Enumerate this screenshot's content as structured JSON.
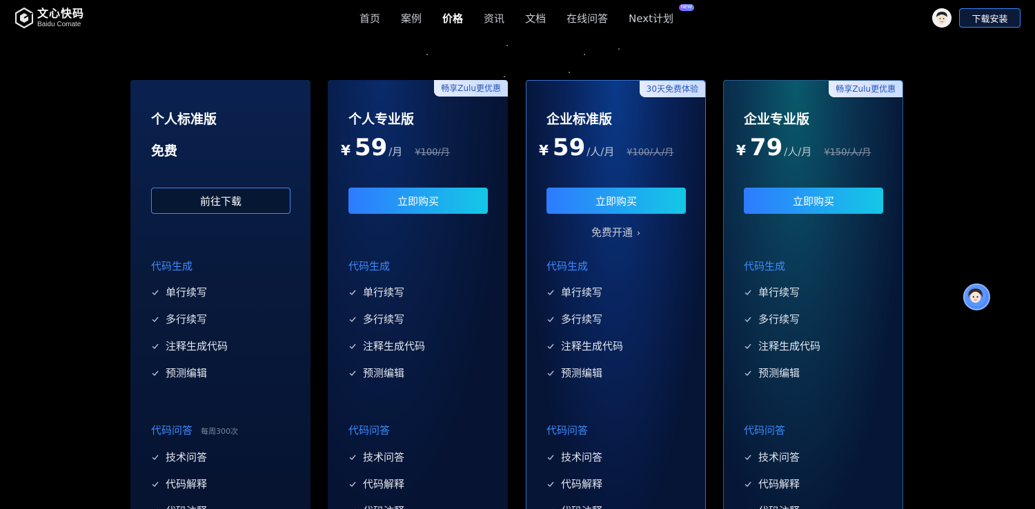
{
  "header": {
    "logo_cn": "文心快码",
    "logo_en": "Baidu Comate",
    "nav": [
      {
        "label": "首页"
      },
      {
        "label": "案例"
      },
      {
        "label": "价格"
      },
      {
        "label": "资讯"
      },
      {
        "label": "文档"
      },
      {
        "label": "在线问答"
      },
      {
        "label": "Next计划",
        "badge": "NEW"
      }
    ],
    "active_nav": "价格",
    "download_label": "下载安装"
  },
  "plans": [
    {
      "title": "个人标准版",
      "price_free": "免费",
      "button": "前往下载",
      "sections": [
        {
          "title": "代码生成",
          "features": [
            "单行续写",
            "多行续写",
            "注释生成代码",
            "预测编辑"
          ]
        },
        {
          "title": "代码问答",
          "note": "每周300次",
          "features": [
            "技术问答",
            "代码解释",
            "代码注释"
          ]
        }
      ]
    },
    {
      "tag": "畅享Zulu更优惠",
      "title": "个人专业版",
      "currency": "¥",
      "amount": "59",
      "unit": "/月",
      "original": "¥100/月",
      "button": "立即购买",
      "sections": [
        {
          "title": "代码生成",
          "features": [
            "单行续写",
            "多行续写",
            "注释生成代码",
            "预测编辑"
          ]
        },
        {
          "title": "代码问答",
          "features": [
            "技术问答",
            "代码解释",
            "代码注释"
          ]
        }
      ]
    },
    {
      "tag": "30天免费体验",
      "title": "企业标准版",
      "currency": "¥",
      "amount": "59",
      "unit": "/人/月",
      "original": "¥100/人/月",
      "button": "立即购买",
      "free_link": "免费开通",
      "sections": [
        {
          "title": "代码生成",
          "features": [
            "单行续写",
            "多行续写",
            "注释生成代码",
            "预测编辑"
          ]
        },
        {
          "title": "代码问答",
          "features": [
            "技术问答",
            "代码解释",
            "代码注释"
          ]
        }
      ]
    },
    {
      "tag": "畅享Zulu更优惠",
      "title": "企业专业版",
      "currency": "¥",
      "amount": "79",
      "unit": "/人/月",
      "original": "¥150/人/月",
      "button": "立即购买",
      "sections": [
        {
          "title": "代码生成",
          "features": [
            "单行续写",
            "多行续写",
            "注释生成代码",
            "预测编辑"
          ]
        },
        {
          "title": "代码问答",
          "features": [
            "技术问答",
            "代码解释",
            "代码注释"
          ]
        }
      ]
    }
  ],
  "colors": {
    "accent": "#3d8bff",
    "button_gradient_start": "#2e7bff",
    "button_gradient_end": "#14c8e6",
    "tag_text": "#2a56b8"
  },
  "icons": [
    "logo-mark-icon",
    "check-icon",
    "chevron-right-icon",
    "user-avatar",
    "assistant-avatar"
  ]
}
